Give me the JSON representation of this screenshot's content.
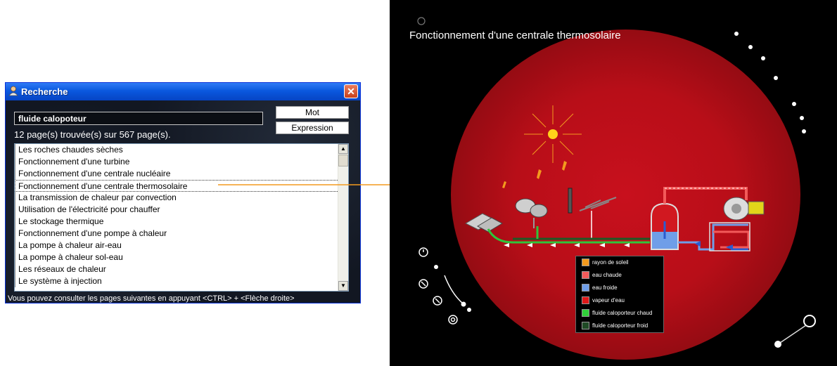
{
  "window": {
    "title": "Recherche",
    "close_label": "✕"
  },
  "search": {
    "query": "fluide calopoteur",
    "result_count": "12 page(s) trouvée(s) sur 567 page(s).",
    "mode_word": "Mot",
    "mode_expression": "Expression",
    "footer_hint": "Vous pouvez consulter les pages suivantes en appuyant <CTRL> + <Flèche droite>"
  },
  "results": [
    "Les roches chaudes sèches",
    "Fonctionnement d'une turbine",
    "Fonctionnement d'une centrale nucléaire",
    "Fonctionnement d'une centrale thermosolaire",
    "La transmission de chaleur par convection",
    "Utilisation de l'électricité pour chauffer",
    "Le stockage thermique",
    "Fonctionnement d'une pompe à chaleur",
    "La pompe à chaleur air-eau",
    "La pompe à chaleur sol-eau",
    "Les réseaux de chaleur",
    "Le système à injection"
  ],
  "selected_index": 3,
  "viz": {
    "title": "Fonctionnement d'une centrale thermosolaire",
    "legend": [
      {
        "label": "rayon de soleil",
        "color": "#f39a1e"
      },
      {
        "label": "eau chaude",
        "color": "#f25a5a"
      },
      {
        "label": "eau froide",
        "color": "#6f9ee8"
      },
      {
        "label": "vapeur d'eau",
        "color": "#e01818"
      },
      {
        "label": "fluide caloporteur chaud",
        "color": "#31d13a"
      },
      {
        "label": "fluide caloporteur froid",
        "color": "#1f4a25"
      }
    ]
  },
  "colors": {
    "arrow": "#f39a1e",
    "titlebar": "#0a58de",
    "disk": "#c8101d"
  },
  "icons": {
    "app": "person-icon",
    "close": "close-icon"
  }
}
